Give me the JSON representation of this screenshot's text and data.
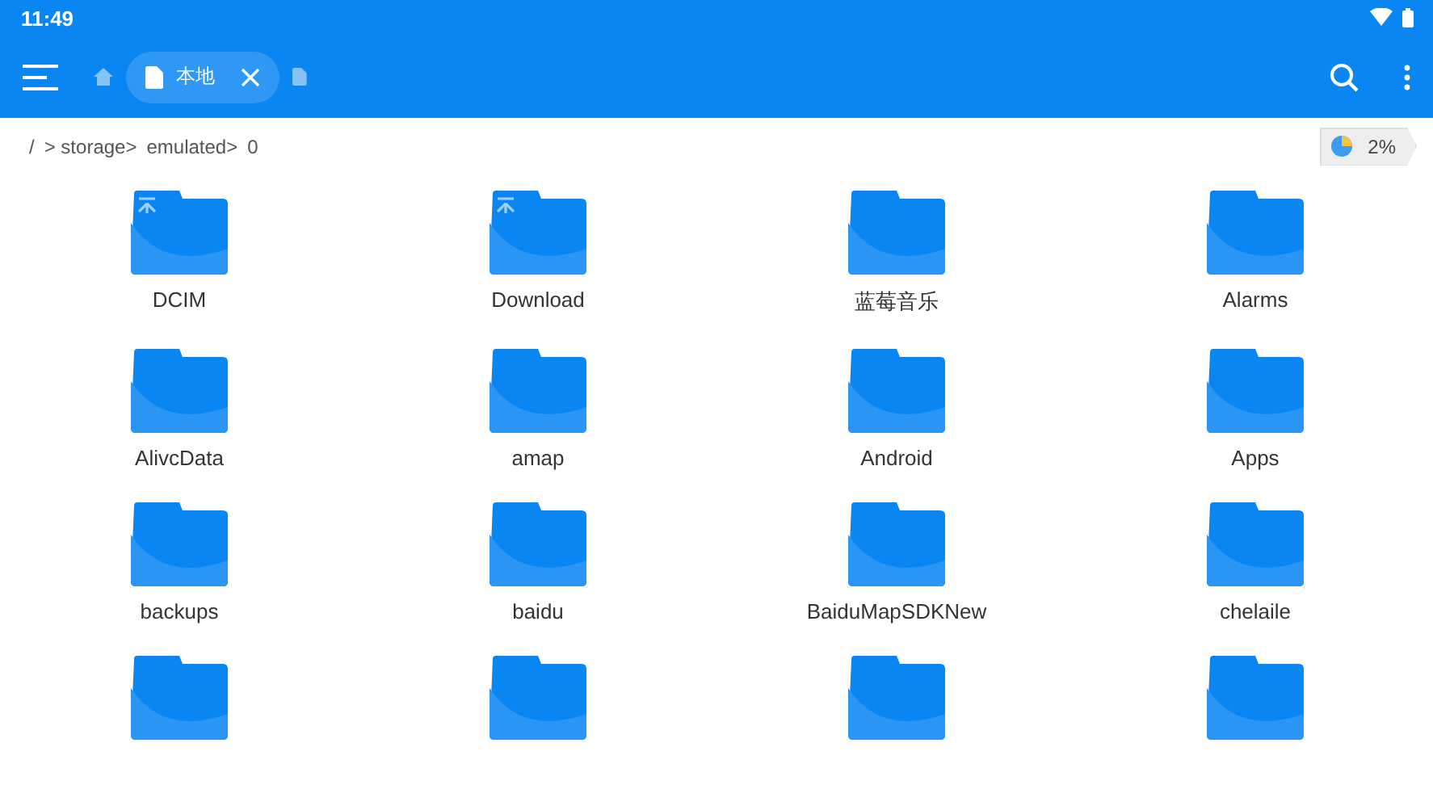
{
  "status_bar": {
    "time": "11:49"
  },
  "tabs": [
    {
      "kind": "home",
      "selected": false
    },
    {
      "kind": "file",
      "label": "本地",
      "selected": true
    },
    {
      "kind": "file",
      "selected": false
    }
  ],
  "breadcrumb": [
    "/",
    "> storage>",
    "emulated>",
    "0"
  ],
  "storage_badge": {
    "text": "2%"
  },
  "folders": [
    {
      "name": "DCIM",
      "kind": "pinned"
    },
    {
      "name": "Download",
      "kind": "pinned"
    },
    {
      "name": "蓝莓音乐",
      "kind": "plain"
    },
    {
      "name": "Alarms",
      "kind": "plain"
    },
    {
      "name": "AlivcData",
      "kind": "plain"
    },
    {
      "name": "amap",
      "kind": "plain"
    },
    {
      "name": "Android",
      "kind": "plain"
    },
    {
      "name": "Apps",
      "kind": "plain"
    },
    {
      "name": "backups",
      "kind": "plain"
    },
    {
      "name": "baidu",
      "kind": "plain"
    },
    {
      "name": "BaiduMapSDKNew",
      "kind": "plain"
    },
    {
      "name": "chelaile",
      "kind": "plain"
    },
    {
      "kind": "plain"
    },
    {
      "kind": "plain"
    },
    {
      "kind": "plain"
    },
    {
      "kind": "plain"
    }
  ]
}
